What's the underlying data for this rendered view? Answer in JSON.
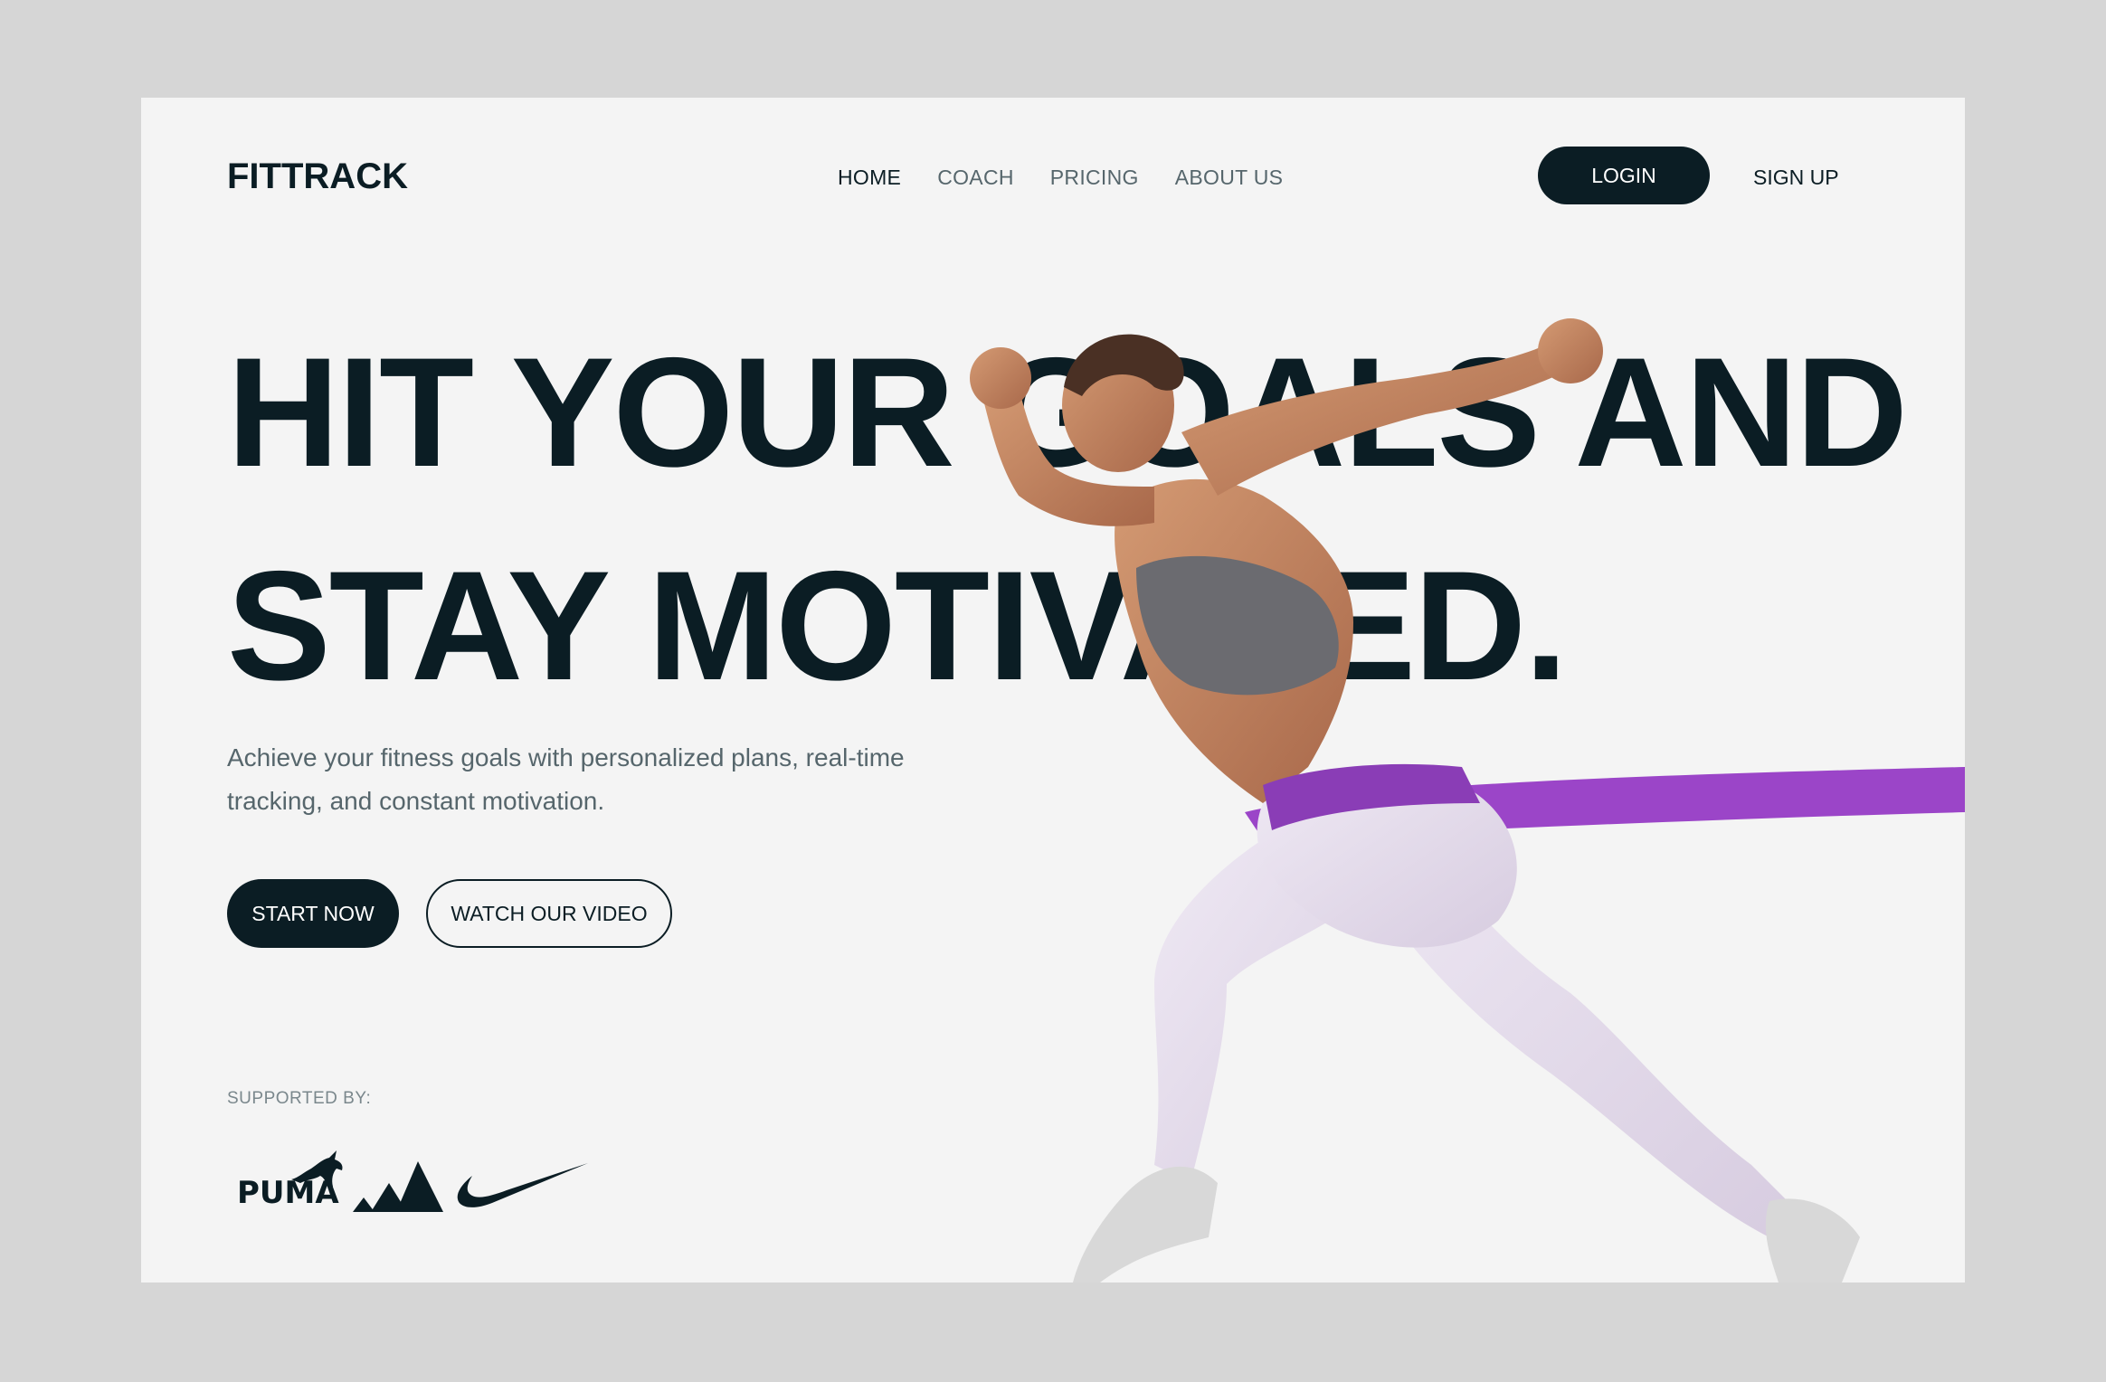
{
  "app": {
    "logo": "FITTRACK"
  },
  "nav": {
    "items": [
      {
        "label": "HOME",
        "active": true
      },
      {
        "label": "COACH",
        "active": false
      },
      {
        "label": "PRICING",
        "active": false
      },
      {
        "label": "ABOUT US",
        "active": false
      }
    ]
  },
  "auth": {
    "login_label": "LOGIN",
    "signup_label": "SIGN UP"
  },
  "hero": {
    "headline_line1": "HIT YOUR GOALS AND",
    "headline_line2": "STAY MOTIVATED.",
    "subtitle": "Achieve your fitness goals with personalized plans, real-time tracking, and constant motivation.",
    "primary_cta": "START NOW",
    "secondary_cta": "WATCH OUR VIDEO"
  },
  "sponsors": {
    "label": "SUPPORTED BY:",
    "brands": [
      {
        "name": "PUMA",
        "icon": "puma-logo"
      },
      {
        "name": "adidas",
        "icon": "adidas-logo"
      },
      {
        "name": "Nike",
        "icon": "nike-swoosh"
      }
    ]
  },
  "colors": {
    "background": "#d6d6d6",
    "page": "#f4f4f4",
    "primary": "#0b1d24",
    "muted": "#56666c",
    "band": "#9b45c8"
  }
}
